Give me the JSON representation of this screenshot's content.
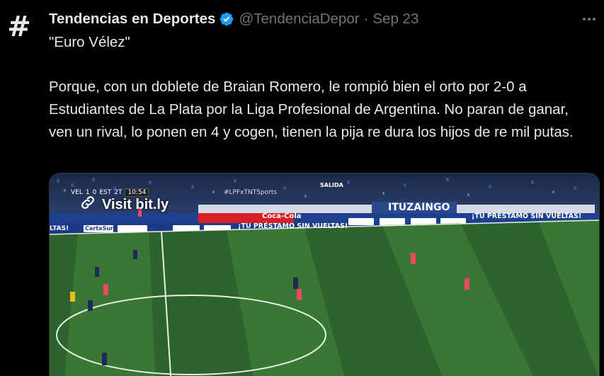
{
  "account": {
    "display_name": "Tendencias en Deportes",
    "handle": "@TendenciaDepor",
    "separator": "·",
    "date": "Sep 23",
    "avatar_glyph": "#"
  },
  "tweet": {
    "line1": "\"Euro Vélez\"",
    "paragraph": "Porque, con un doblete de Braian Romero, le rompió bien el orto por 2-0 a Estudiantes de La Plata por la Liga Profesional de Argentina. No paran de ganar, ven un rival, lo ponen en 4 y cogen, tienen la pija re dura los hijos de re mil putas."
  },
  "media": {
    "link_label": "Visit bit.ly",
    "scoreboard": {
      "home": "VEL",
      "home_score": "1",
      "away_score": "0",
      "away": "EST",
      "period": "2T",
      "clock": "10:54"
    },
    "hashtag": "#LPFxTNTSports",
    "board_text_1": "¡TU PRÉSTAMO SIN VUELTAS!",
    "board_text_2": "¡TU PRÉSTAMO SIN VUELTAS!",
    "board_left": "LTAS!",
    "sponsor": "CartaSur",
    "sign_salida": "SALIDA",
    "stand_banner": "ITUZAINGO",
    "coke": "Coca-Cola"
  },
  "colors": {
    "accent": "#1d9bf0",
    "muted": "#71767b",
    "text": "#e7e9ea",
    "pitch_dark": "#2b5f2a",
    "pitch_light": "#3c7a35"
  },
  "icons": {
    "verified": "verified-badge-icon",
    "more": "more-options-icon",
    "link": "link-icon"
  }
}
